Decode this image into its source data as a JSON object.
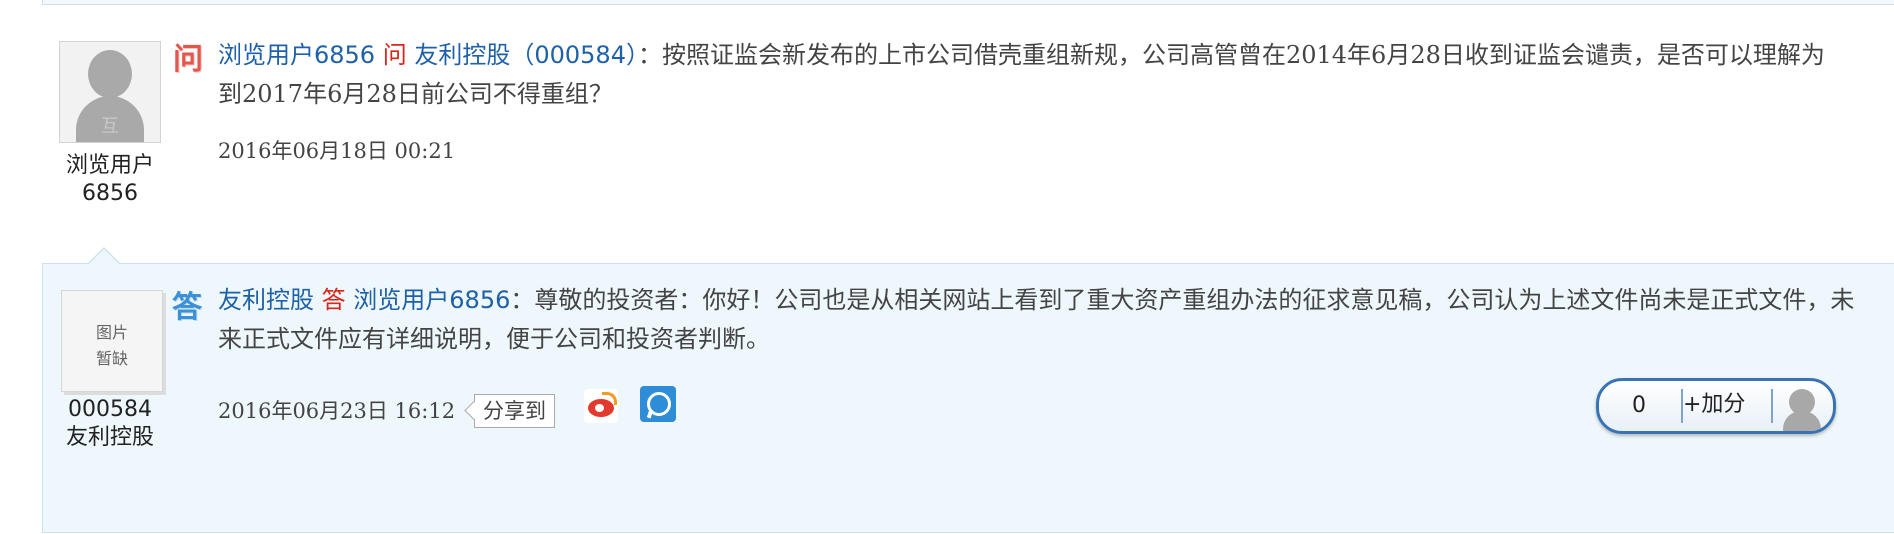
{
  "question": {
    "avatar_mark": "互",
    "asker_name": "浏览用户6856",
    "icon_label": "问",
    "asker": "浏览用户6856",
    "verb": "问",
    "target": "友利控股（000584）",
    "separator": "：",
    "content": "按照证监会新发布的上市公司借壳重组新规，公司高管曾在2014年6月28日收到证监会谴责，是否可以理解为到2017年6月28日前公司不得重组？",
    "time": "2016年06月18日 00:21"
  },
  "answer": {
    "avatar_placeholder_line1": "图片",
    "avatar_placeholder_line2": "暂缺",
    "responder_code": "000584",
    "responder_short_name": "友利控股",
    "icon_label": "答",
    "responder": "友利控股",
    "verb": "答",
    "target": "浏览用户6856",
    "separator": "：",
    "content": "尊敬的投资者：你好！公司也是从相关网站上看到了重大资产重组办法的征求意见稿，公司认为上述文件尚未是正式文件，未来正式文件应有详细说明，便于公司和投资者判断。",
    "time": "2016年06月23日 16:12",
    "share_label": "分享到",
    "share_icons": [
      "weibo-icon",
      "tencent-weibo-icon"
    ],
    "score": {
      "count": "0",
      "add_label": "+加分"
    }
  },
  "colors": {
    "link_blue": "#1f61a8",
    "verb_red": "#d8261a",
    "question_icon": "#e2584e",
    "answer_icon": "#3c91d6",
    "answer_background": "#eef7fb"
  }
}
